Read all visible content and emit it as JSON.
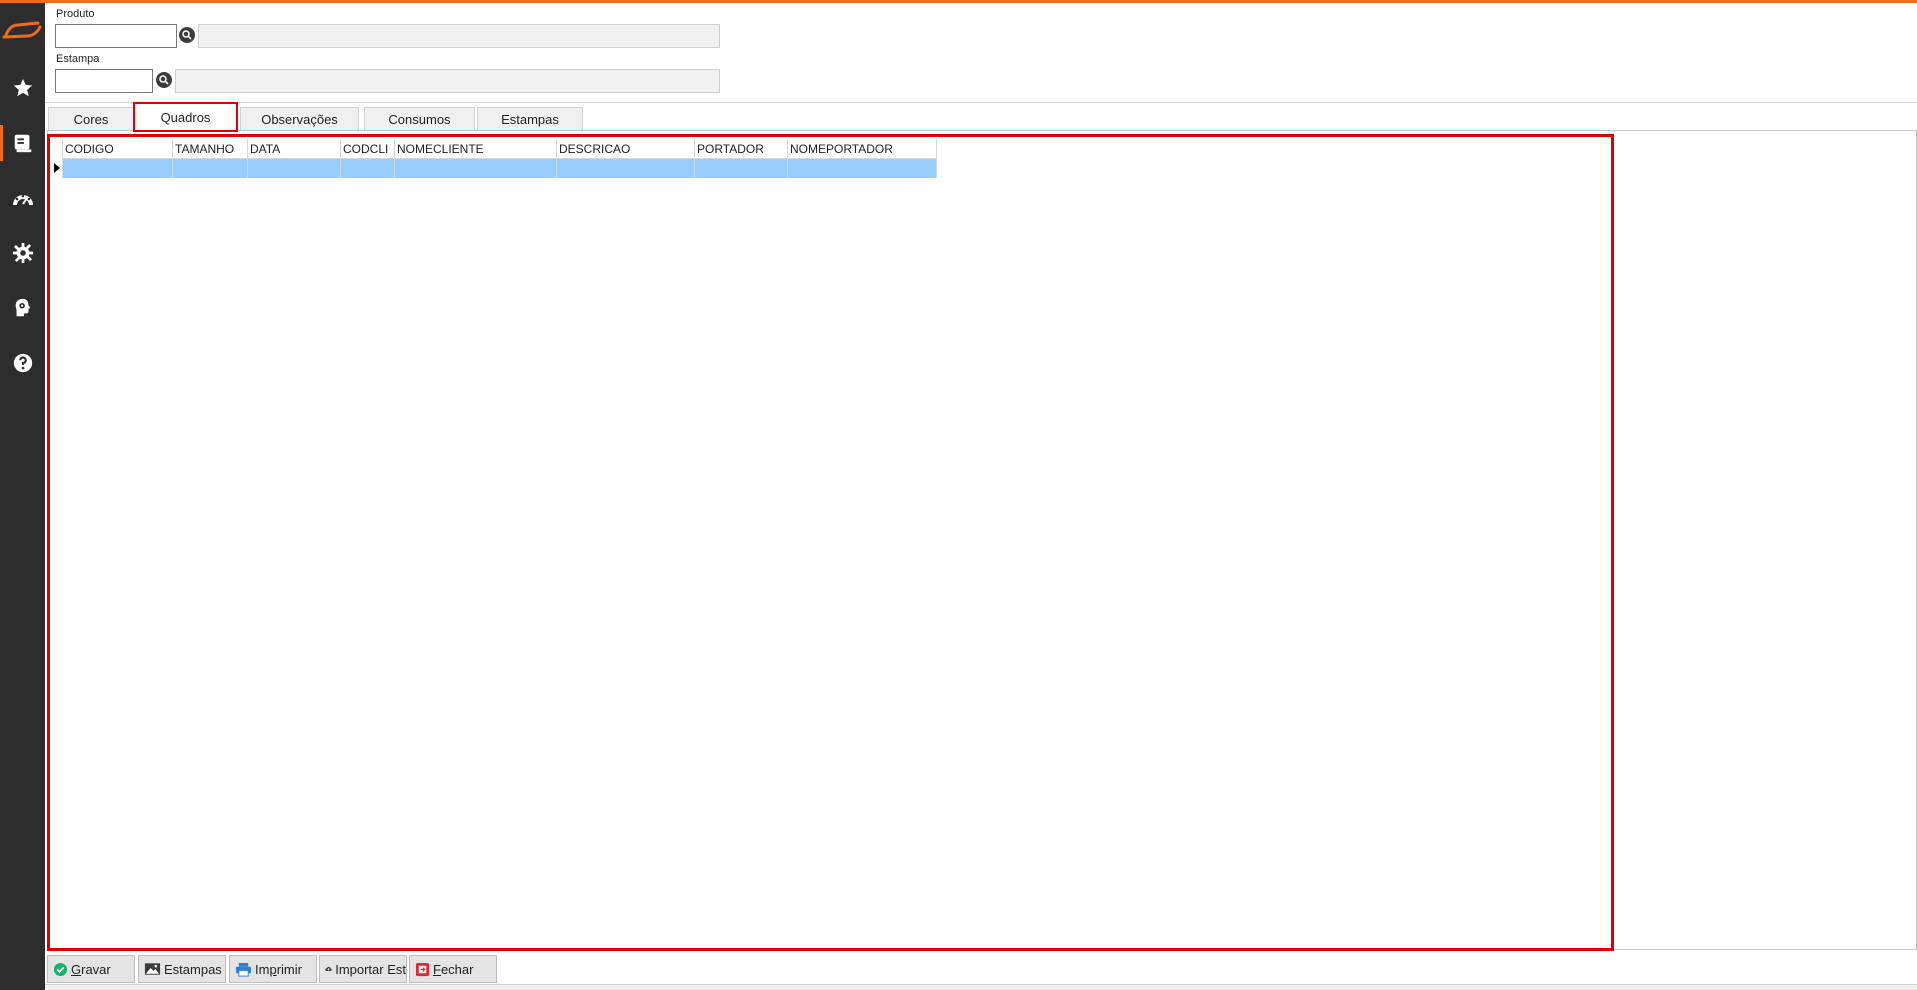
{
  "header": {
    "produto_label": "Produto",
    "produto_value": "",
    "estampa_label": "Estampa",
    "estampa_value": ""
  },
  "tabs": [
    {
      "label": "Cores"
    },
    {
      "label": "Quadros"
    },
    {
      "label": "Observações"
    },
    {
      "label": "Consumos"
    },
    {
      "label": "Estampas"
    }
  ],
  "active_tab": "Quadros",
  "grid": {
    "columns": [
      "CODIGO",
      "TAMANHO",
      "DATA",
      "CODCLI",
      "NOMECLIENTE",
      "DESCRICAO",
      "PORTADOR",
      "NOMEPORTADOR"
    ],
    "rows": [
      [
        "",
        "",
        "",
        "",
        "",
        "",
        "",
        ""
      ]
    ]
  },
  "buttons": {
    "gravar": {
      "prefix": "",
      "accel": "G",
      "rest": "ravar"
    },
    "estampas": {
      "label": "Estampas"
    },
    "imprimir": {
      "prefix": "Im",
      "accel": "p",
      "rest": "rimir"
    },
    "importar": {
      "label": "Importar Est"
    },
    "fechar": {
      "prefix": "",
      "accel": "F",
      "rest": "echar"
    }
  },
  "sidebar": {
    "items": [
      "logo-icon",
      "star-icon",
      "register-icon",
      "dashboard-icon",
      "gear-icon",
      "head-gear-icon",
      "help-icon"
    ]
  },
  "colors": {
    "accent": "#f06a1c",
    "highlight": "#e00000",
    "selected_row": "#99ccff",
    "sidebar_bg": "#2d2d2d"
  }
}
